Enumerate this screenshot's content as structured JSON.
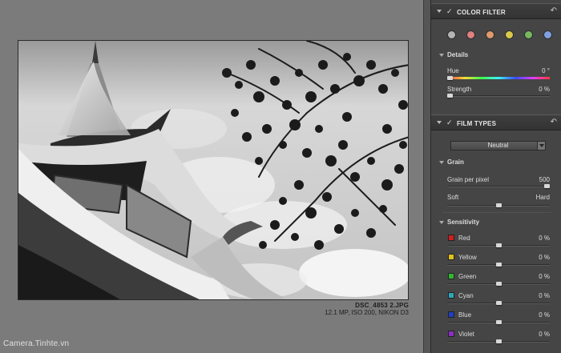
{
  "photo": {
    "filename": "DSC_4853 2.JPG",
    "info": "12.1 MP, ISO 200, NIKON D3"
  },
  "watermark": "Camera.Tinhte.vn",
  "color_filter": {
    "title": "COLOR FILTER",
    "enabled": true,
    "dots": [
      {
        "name": "gray",
        "color": "#b3b3b3"
      },
      {
        "name": "red",
        "color": "#e08080"
      },
      {
        "name": "orange",
        "color": "#e09a6c"
      },
      {
        "name": "yellow",
        "color": "#d9c94a"
      },
      {
        "name": "green",
        "color": "#77b85f"
      },
      {
        "name": "blue",
        "color": "#7fa0e0"
      }
    ],
    "details": {
      "label": "Details",
      "hue": {
        "label": "Hue",
        "value": "0 °",
        "level": 0
      },
      "strength": {
        "label": "Strength",
        "value": "0 %",
        "level": 0
      }
    }
  },
  "film_types": {
    "title": "FILM TYPES",
    "enabled": true,
    "preset": "Neutral",
    "grain": {
      "label": "Grain",
      "grain_per_pixel": {
        "label": "Grain per pixel",
        "value": "500",
        "level": 1.0
      },
      "soft_label": "Soft",
      "hard_label": "Hard",
      "softness_level": 0.5
    },
    "sensitivity": {
      "label": "Sensitivity",
      "rows": [
        {
          "label": "Red",
          "value": "0 %",
          "color": "#d21c1c",
          "level": 0.5
        },
        {
          "label": "Yellow",
          "value": "0 %",
          "color": "#e0c21a",
          "level": 0.5
        },
        {
          "label": "Green",
          "value": "0 %",
          "color": "#2fb82f",
          "level": 0.5
        },
        {
          "label": "Cyan",
          "value": "0 %",
          "color": "#2fa6b8",
          "level": 0.5
        },
        {
          "label": "Blue",
          "value": "0 %",
          "color": "#1f3fbf",
          "level": 0.5
        },
        {
          "label": "Violet",
          "value": "0 %",
          "color": "#8a2fc2",
          "level": 0.5
        }
      ]
    }
  }
}
